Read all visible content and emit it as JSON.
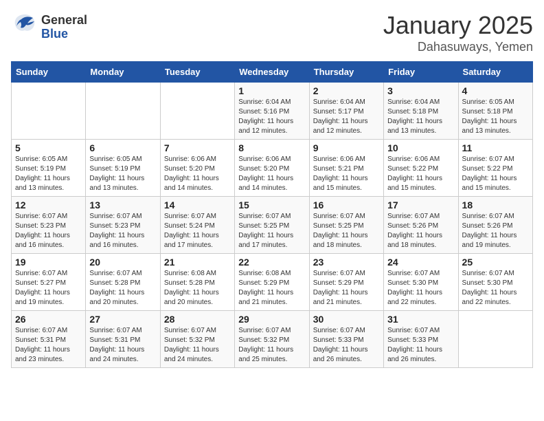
{
  "logo": {
    "general": "General",
    "blue": "Blue"
  },
  "title": "January 2025",
  "subtitle": "Dahasuways, Yemen",
  "days_of_week": [
    "Sunday",
    "Monday",
    "Tuesday",
    "Wednesday",
    "Thursday",
    "Friday",
    "Saturday"
  ],
  "weeks": [
    [
      {
        "day": "",
        "info": ""
      },
      {
        "day": "",
        "info": ""
      },
      {
        "day": "",
        "info": ""
      },
      {
        "day": "1",
        "info": "Sunrise: 6:04 AM\nSunset: 5:16 PM\nDaylight: 11 hours and 12 minutes."
      },
      {
        "day": "2",
        "info": "Sunrise: 6:04 AM\nSunset: 5:17 PM\nDaylight: 11 hours and 12 minutes."
      },
      {
        "day": "3",
        "info": "Sunrise: 6:04 AM\nSunset: 5:18 PM\nDaylight: 11 hours and 13 minutes."
      },
      {
        "day": "4",
        "info": "Sunrise: 6:05 AM\nSunset: 5:18 PM\nDaylight: 11 hours and 13 minutes."
      }
    ],
    [
      {
        "day": "5",
        "info": "Sunrise: 6:05 AM\nSunset: 5:19 PM\nDaylight: 11 hours and 13 minutes."
      },
      {
        "day": "6",
        "info": "Sunrise: 6:05 AM\nSunset: 5:19 PM\nDaylight: 11 hours and 13 minutes."
      },
      {
        "day": "7",
        "info": "Sunrise: 6:06 AM\nSunset: 5:20 PM\nDaylight: 11 hours and 14 minutes."
      },
      {
        "day": "8",
        "info": "Sunrise: 6:06 AM\nSunset: 5:20 PM\nDaylight: 11 hours and 14 minutes."
      },
      {
        "day": "9",
        "info": "Sunrise: 6:06 AM\nSunset: 5:21 PM\nDaylight: 11 hours and 15 minutes."
      },
      {
        "day": "10",
        "info": "Sunrise: 6:06 AM\nSunset: 5:22 PM\nDaylight: 11 hours and 15 minutes."
      },
      {
        "day": "11",
        "info": "Sunrise: 6:07 AM\nSunset: 5:22 PM\nDaylight: 11 hours and 15 minutes."
      }
    ],
    [
      {
        "day": "12",
        "info": "Sunrise: 6:07 AM\nSunset: 5:23 PM\nDaylight: 11 hours and 16 minutes."
      },
      {
        "day": "13",
        "info": "Sunrise: 6:07 AM\nSunset: 5:23 PM\nDaylight: 11 hours and 16 minutes."
      },
      {
        "day": "14",
        "info": "Sunrise: 6:07 AM\nSunset: 5:24 PM\nDaylight: 11 hours and 17 minutes."
      },
      {
        "day": "15",
        "info": "Sunrise: 6:07 AM\nSunset: 5:25 PM\nDaylight: 11 hours and 17 minutes."
      },
      {
        "day": "16",
        "info": "Sunrise: 6:07 AM\nSunset: 5:25 PM\nDaylight: 11 hours and 18 minutes."
      },
      {
        "day": "17",
        "info": "Sunrise: 6:07 AM\nSunset: 5:26 PM\nDaylight: 11 hours and 18 minutes."
      },
      {
        "day": "18",
        "info": "Sunrise: 6:07 AM\nSunset: 5:26 PM\nDaylight: 11 hours and 19 minutes."
      }
    ],
    [
      {
        "day": "19",
        "info": "Sunrise: 6:07 AM\nSunset: 5:27 PM\nDaylight: 11 hours and 19 minutes."
      },
      {
        "day": "20",
        "info": "Sunrise: 6:07 AM\nSunset: 5:28 PM\nDaylight: 11 hours and 20 minutes."
      },
      {
        "day": "21",
        "info": "Sunrise: 6:08 AM\nSunset: 5:28 PM\nDaylight: 11 hours and 20 minutes."
      },
      {
        "day": "22",
        "info": "Sunrise: 6:08 AM\nSunset: 5:29 PM\nDaylight: 11 hours and 21 minutes."
      },
      {
        "day": "23",
        "info": "Sunrise: 6:07 AM\nSunset: 5:29 PM\nDaylight: 11 hours and 21 minutes."
      },
      {
        "day": "24",
        "info": "Sunrise: 6:07 AM\nSunset: 5:30 PM\nDaylight: 11 hours and 22 minutes."
      },
      {
        "day": "25",
        "info": "Sunrise: 6:07 AM\nSunset: 5:30 PM\nDaylight: 11 hours and 22 minutes."
      }
    ],
    [
      {
        "day": "26",
        "info": "Sunrise: 6:07 AM\nSunset: 5:31 PM\nDaylight: 11 hours and 23 minutes."
      },
      {
        "day": "27",
        "info": "Sunrise: 6:07 AM\nSunset: 5:31 PM\nDaylight: 11 hours and 24 minutes."
      },
      {
        "day": "28",
        "info": "Sunrise: 6:07 AM\nSunset: 5:32 PM\nDaylight: 11 hours and 24 minutes."
      },
      {
        "day": "29",
        "info": "Sunrise: 6:07 AM\nSunset: 5:32 PM\nDaylight: 11 hours and 25 minutes."
      },
      {
        "day": "30",
        "info": "Sunrise: 6:07 AM\nSunset: 5:33 PM\nDaylight: 11 hours and 26 minutes."
      },
      {
        "day": "31",
        "info": "Sunrise: 6:07 AM\nSunset: 5:33 PM\nDaylight: 11 hours and 26 minutes."
      },
      {
        "day": "",
        "info": ""
      }
    ]
  ]
}
